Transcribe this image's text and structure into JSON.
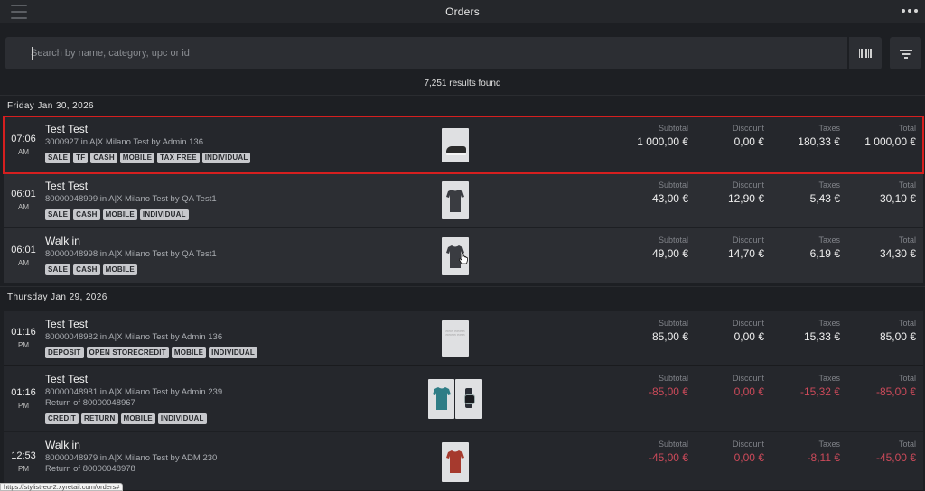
{
  "header": {
    "title": "Orders"
  },
  "search": {
    "placeholder": "Search by name, category, upc or id"
  },
  "results_text": "7,251 results found",
  "groups": [
    {
      "date": "Friday Jan 30, 2026",
      "orders": [
        {
          "time": "07:06",
          "ampm": "AM",
          "name": "Test Test",
          "sub": "3000927 in A|X Milano Test by Admin 136",
          "sub2": "",
          "tags": [
            "SALE",
            "TF",
            "CASH",
            "MOBILE",
            "TAX FREE",
            "INDIVIDUAL"
          ],
          "product": "sneaker",
          "selected": true,
          "subtotal": "1 000,00 €",
          "discount": "0,00 €",
          "taxes": "180,33 €",
          "total": "1 000,00 €",
          "negative": false
        },
        {
          "time": "06:01",
          "ampm": "AM",
          "name": "Test Test",
          "sub": "80000048999 in A|X Milano Test by QA Test1",
          "sub2": "",
          "tags": [
            "SALE",
            "CASH",
            "MOBILE",
            "INDIVIDUAL"
          ],
          "product": "dark-tshirt",
          "subtotal": "43,00 €",
          "discount": "12,90 €",
          "taxes": "5,43 €",
          "total": "30,10 €",
          "negative": false
        },
        {
          "time": "06:01",
          "ampm": "AM",
          "name": "Walk in",
          "sub": "80000048998 in A|X Milano Test by QA Test1",
          "sub2": "",
          "tags": [
            "SALE",
            "CASH",
            "MOBILE"
          ],
          "product": "dark-tshirt",
          "subtotal": "49,00 €",
          "discount": "14,70 €",
          "taxes": "6,19 €",
          "total": "34,30 €",
          "negative": false
        }
      ]
    },
    {
      "date": "Thursday Jan 29, 2026",
      "orders": [
        {
          "time": "01:16",
          "ampm": "PM",
          "name": "Test Test",
          "sub": "80000048982 in A|X Milano Test by Admin 136",
          "sub2": "",
          "tags": [
            "DEPOSIT",
            "OPEN STORECREDIT",
            "MOBILE",
            "INDIVIDUAL"
          ],
          "product": "not-available",
          "subtotal": "85,00 €",
          "discount": "0,00 €",
          "taxes": "15,33 €",
          "total": "85,00 €",
          "negative": false
        },
        {
          "time": "01:16",
          "ampm": "PM",
          "name": "Test Test",
          "sub": "80000048981 in A|X Milano Test by Admin 239",
          "sub2": "Return of 80000048967",
          "tags": [
            "CREDIT",
            "RETURN",
            "MOBILE",
            "INDIVIDUAL"
          ],
          "product": "teal-tshirt-and-watch",
          "subtotal": "-85,00 €",
          "discount": "0,00 €",
          "taxes": "-15,32 €",
          "total": "-85,00 €",
          "negative": true
        },
        {
          "time": "12:53",
          "ampm": "PM",
          "name": "Walk in",
          "sub": "80000048979 in A|X Milano Test by ADM 230",
          "sub2": "Return of 80000048978",
          "tags": [],
          "product": "red-tshirt",
          "subtotal": "-45,00 €",
          "discount": "0,00 €",
          "taxes": "-8,11 €",
          "total": "-45,00 €",
          "negative": true
        }
      ]
    }
  ],
  "columns": {
    "subtotal": "Subtotal",
    "discount": "Discount",
    "taxes": "Taxes",
    "total": "Total"
  },
  "statusbar": {
    "url": "https://stylist-eu-2.xyretail.com/orders#"
  },
  "colors": {
    "selection_outline": "#d61f1f",
    "negative_amount": "#cc4a5a",
    "tag_bg": "#c7c8cc"
  }
}
